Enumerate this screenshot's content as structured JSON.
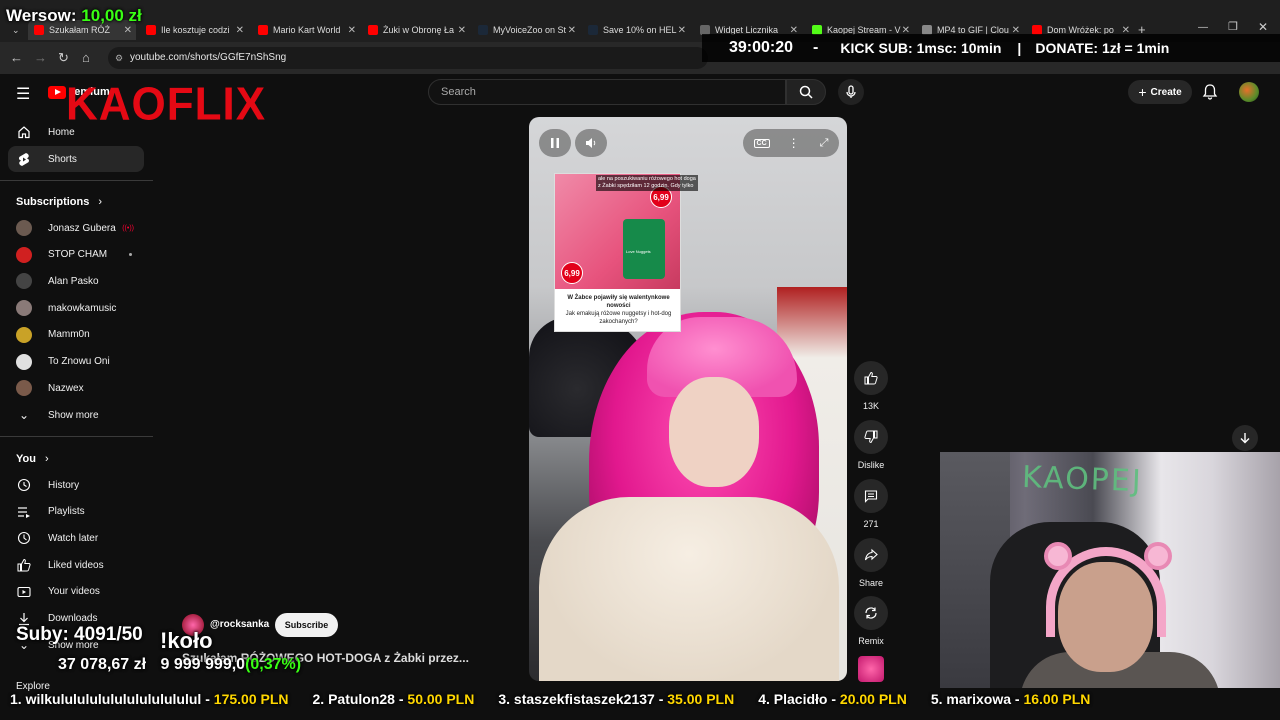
{
  "overlay": {
    "wersow_label": "Wersow:",
    "wersow_amount": "10,00 zł",
    "timer": "39:00:20",
    "dash": "-",
    "kick_sub": "KICK SUB: 1msc: 10min",
    "separator": "|",
    "donate": "DONATE: 1zł = 1min",
    "logo_text": "KAOFLIX",
    "suby": "Suby: 4091/50",
    "kolo": "!koło",
    "goal_current": "37 078,67 zł",
    "goal_target": "9 999 999,0",
    "goal_pct": "(0,37%)",
    "ticker": [
      {
        "rank": "1. wilkulululululululululululul",
        "amount": "175.00 PLN"
      },
      {
        "rank": "2. Patulon28",
        "amount": "50.00 PLN"
      },
      {
        "rank": "3. staszekfistaszek2137",
        "amount": "35.00 PLN"
      },
      {
        "rank": "4. Placidło",
        "amount": "20.00 PLN"
      },
      {
        "rank": "5. marixowa",
        "amount": "16.00 PLN"
      }
    ],
    "webcam_sign": "KAOPEJ"
  },
  "browser": {
    "tabs": [
      {
        "label": "Szukałam RÓŻ",
        "color": "#ff0000"
      },
      {
        "label": "Ile kosztuje codzi",
        "color": "#ff0000"
      },
      {
        "label": "Mario Kart World",
        "color": "#ff0000"
      },
      {
        "label": "Żuki w Obronę Ła",
        "color": "#ff0000"
      },
      {
        "label": "MyVoiceZoo on St",
        "color": "#1b2838"
      },
      {
        "label": "Save 10% on HEL",
        "color": "#1b2838"
      },
      {
        "label": "Widget Licznika",
        "color": "#666666"
      },
      {
        "label": "Kaopej Stream - V",
        "color": "#53fc18"
      },
      {
        "label": "MP4 to GIF | Clou",
        "color": "#888888"
      },
      {
        "label": "Dom Wróżek: po",
        "color": "#ff0000"
      }
    ],
    "url": "youtube.com/shorts/GGfE7nShSng"
  },
  "masthead": {
    "logo_suffix": "remium",
    "search_placeholder": "Search",
    "create_label": "Create"
  },
  "sidebar": {
    "home": "Home",
    "shorts": "Shorts",
    "subscriptions_heading": "Subscriptions",
    "subscriptions": [
      {
        "name": "Jonasz Gubera",
        "color": "#6b5a50"
      },
      {
        "name": "STOP CHAM",
        "color": "#d02020"
      },
      {
        "name": "Alan Pasko",
        "color": "#444444"
      },
      {
        "name": "makowkamusic",
        "color": "#8a7a78"
      },
      {
        "name": "Mamm0n",
        "color": "#c9a227"
      },
      {
        "name": "To Znowu Oni",
        "color": "#e0e0e0"
      },
      {
        "name": "Nazwex",
        "color": "#7a5a4a"
      }
    ],
    "show_more": "Show more",
    "you_heading": "You",
    "you_items": [
      "History",
      "Playlists",
      "Watch later",
      "Liked videos",
      "Your videos",
      "Downloads"
    ],
    "show_more_2": "Show more",
    "explore": "Explore"
  },
  "short": {
    "cc_label": "CC",
    "ad_caption": "ale na poszukiwaniu różowego hot doga z Żabki spędziłam 12 godzin. Gdy tylko",
    "ad_text_bold": "W Żabce pojawiły się walentynkowe nowości",
    "ad_text": "Jak emakują różowe nuggetsy i hot-dog zakochanych?",
    "price1": "6,99",
    "price2": "6,99",
    "ad_product_label": "Love Nuggets"
  },
  "actions": {
    "likes": "13K",
    "dislike": "Dislike",
    "comments": "271",
    "share": "Share",
    "remix": "Remix"
  },
  "video": {
    "channel": "@rocksanka",
    "subscribe": "Subscribe",
    "title": "Szukałam RÓŻOWEGO HOT-DOGA z Żabki przez..."
  }
}
